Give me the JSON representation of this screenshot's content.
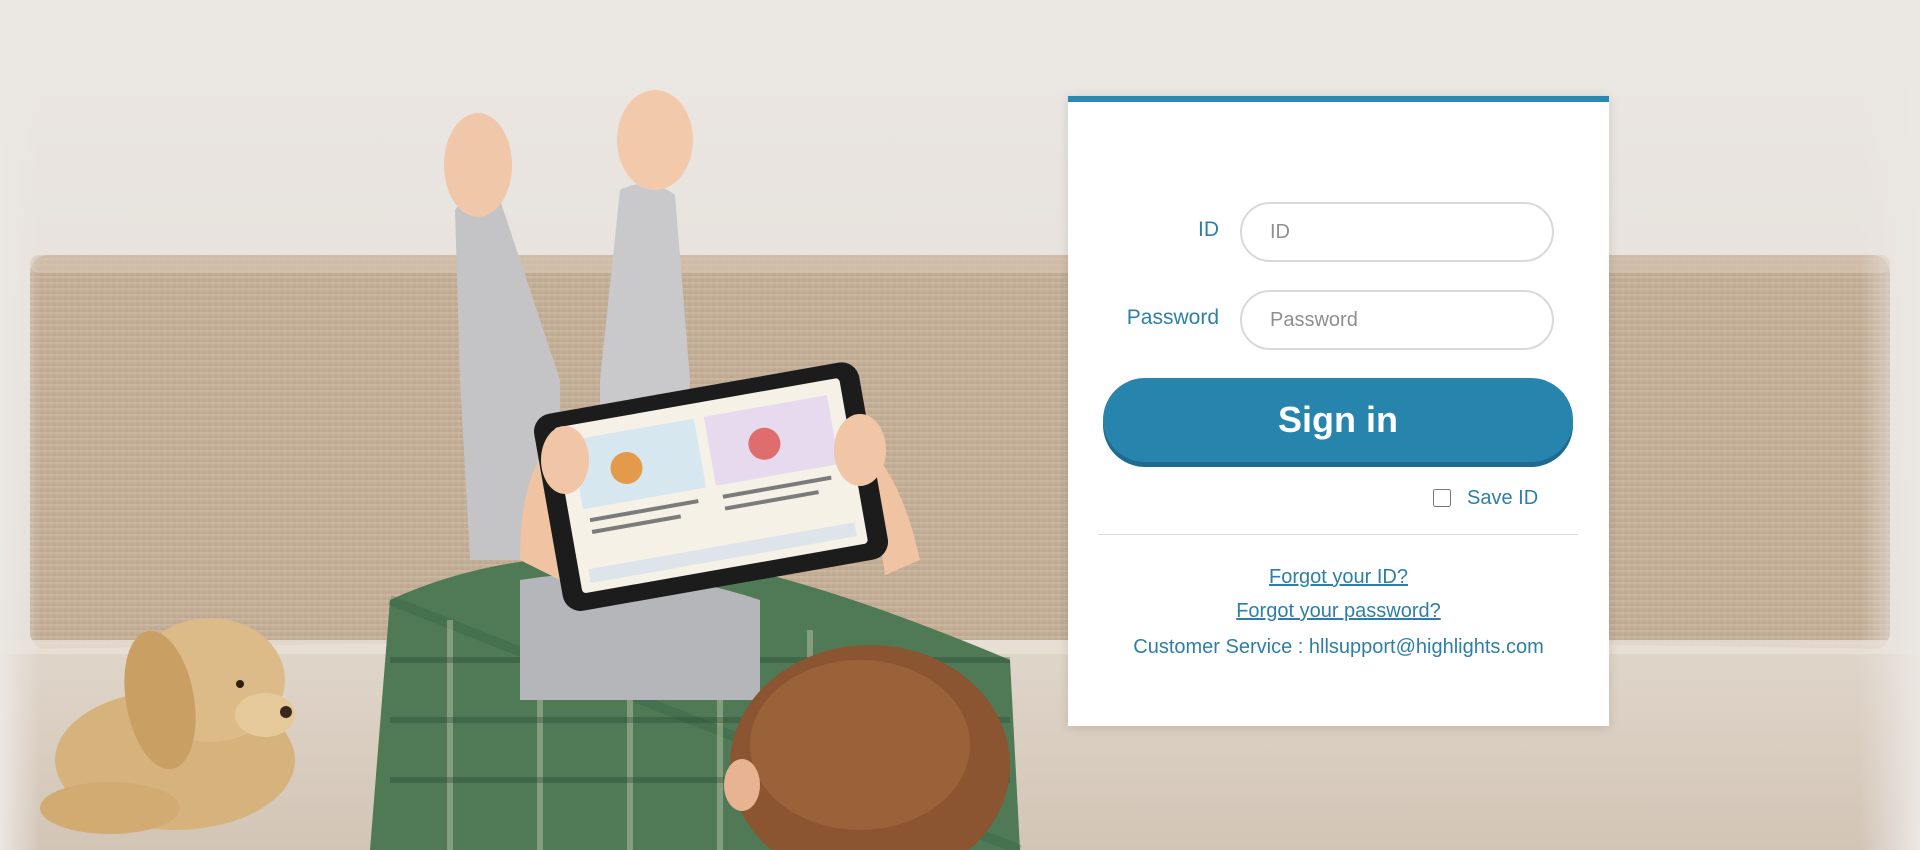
{
  "login": {
    "id_label": "ID",
    "id_placeholder": "ID",
    "password_label": "Password",
    "password_placeholder": "Password",
    "signin_label": "Sign in",
    "save_id_label": "Save ID",
    "forgot_id_label": "Forgot your ID?",
    "forgot_password_label": "Forgot your password?",
    "customer_service_text": "Customer Service : hllsupport@highlights.com"
  },
  "colors": {
    "accent": "#2a89b3",
    "button": "#2784ad",
    "text_link": "#2d7fa8",
    "card_bg": "#ffffff"
  },
  "background": {
    "icons": [
      "boy-with-tablet-illustration",
      "plush-dog-illustration",
      "sofa-illustration"
    ]
  }
}
